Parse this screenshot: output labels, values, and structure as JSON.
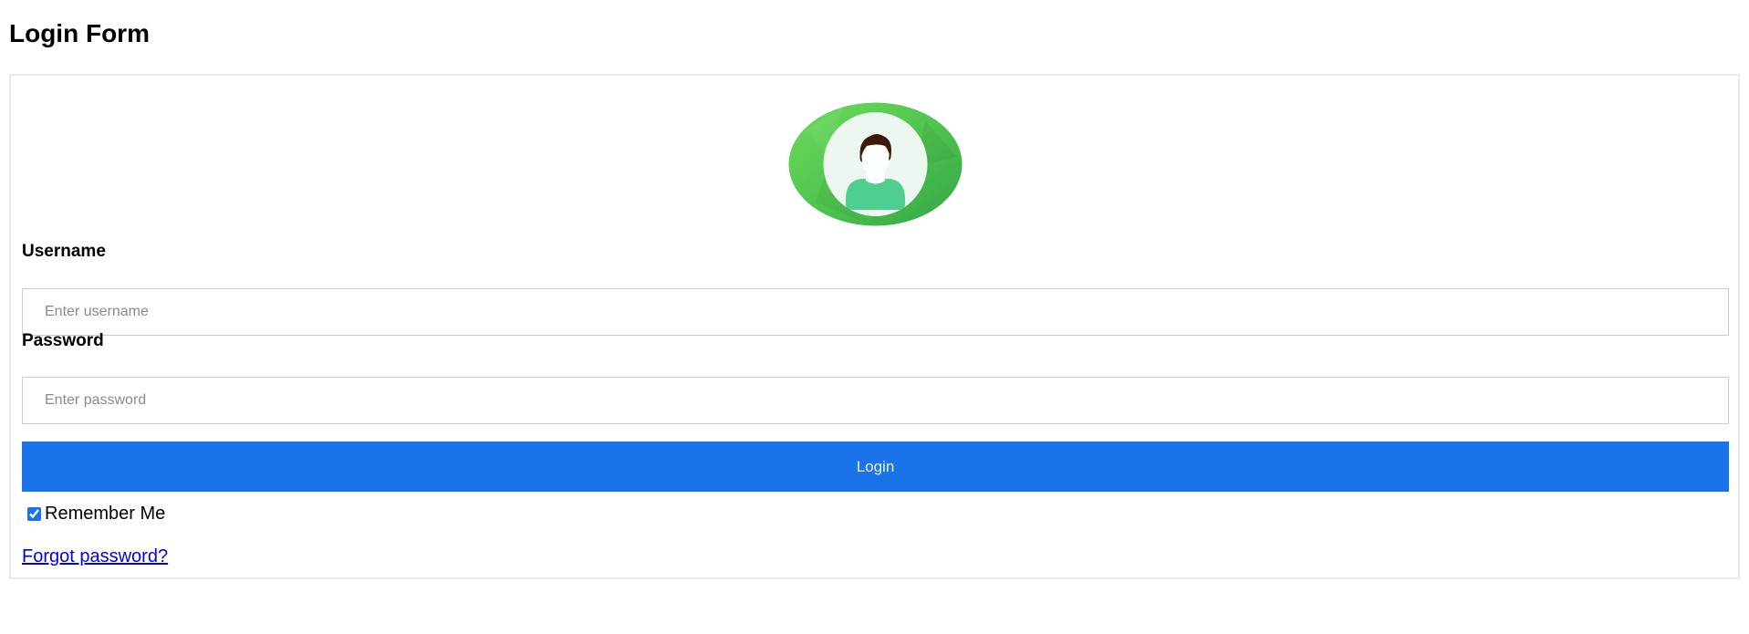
{
  "page": {
    "title": "Login Form"
  },
  "avatar": {
    "icon": "user-avatar-icon",
    "ring_colors": [
      "#5ed35a",
      "#3aa84a"
    ],
    "inner_color": "#eef7ef",
    "shirt_color": "#4fcf8f",
    "hair_color": "#3b1a0c"
  },
  "form": {
    "username": {
      "label": "Username",
      "placeholder": "Enter username",
      "value": ""
    },
    "password": {
      "label": "Password",
      "placeholder": "Enter password",
      "value": ""
    },
    "login_label": "Login",
    "remember_label": "Remember Me",
    "remember_checked": true,
    "forgot_label": "Forgot password?"
  },
  "colors": {
    "accent": "#1a73e8",
    "link": "#0000ee",
    "border": "#cccccc"
  }
}
